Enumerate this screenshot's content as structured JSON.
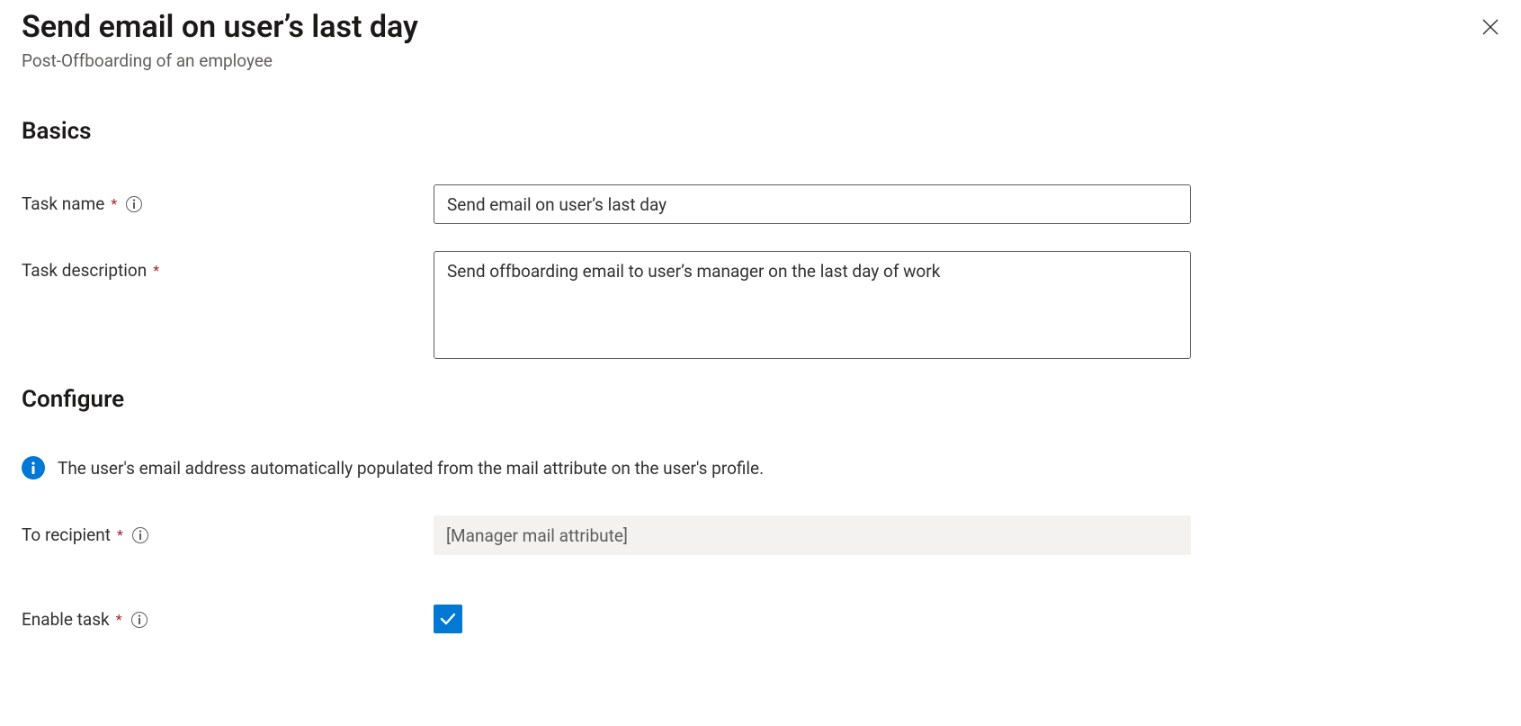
{
  "header": {
    "title": "Send email on user’s last day",
    "subtitle": "Post-Offboarding of an employee"
  },
  "sections": {
    "basics": {
      "heading": "Basics",
      "task_name_label": "Task name",
      "task_name_value": "Send email on user’s last day",
      "task_description_label": "Task description",
      "task_description_value": "Send offboarding email to user’s manager on the last day of work"
    },
    "configure": {
      "heading": "Configure",
      "info_message": "The user's email address automatically populated from the mail attribute on the user's profile.",
      "to_recipient_label": "To recipient",
      "to_recipient_value": "[Manager mail attribute]",
      "enable_task_label": "Enable task",
      "enable_task_checked": true
    }
  }
}
